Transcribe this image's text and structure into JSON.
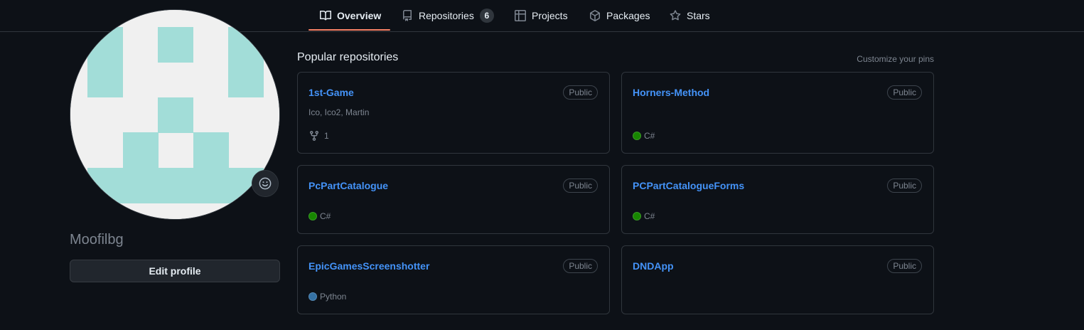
{
  "nav": {
    "tabs": [
      {
        "label": "Overview",
        "icon": "book-icon"
      },
      {
        "label": "Repositories",
        "icon": "repo-icon",
        "count": "6"
      },
      {
        "label": "Projects",
        "icon": "table-icon"
      },
      {
        "label": "Packages",
        "icon": "package-icon"
      },
      {
        "label": "Stars",
        "icon": "star-icon"
      }
    ],
    "selected": "Overview",
    "underline_color": "#f78166"
  },
  "profile": {
    "username": "Moofilbg",
    "edit_label": "Edit profile",
    "avatar_colors": {
      "background": "#f0f0f0",
      "foreground": "#a2ddd8"
    }
  },
  "pinned": {
    "title": "Popular repositories",
    "customize_label": "Customize your pins",
    "repos": [
      {
        "name": "1st-Game",
        "visibility": "Public",
        "description": "Ico, Ico2, Martin",
        "forks": "1"
      },
      {
        "name": "Horners-Method",
        "visibility": "Public",
        "language": "C#",
        "language_color": "#178600"
      },
      {
        "name": "PcPartCatalogue",
        "visibility": "Public",
        "language": "C#",
        "language_color": "#178600"
      },
      {
        "name": "PCPartCatalogueForms",
        "visibility": "Public",
        "language": "C#",
        "language_color": "#178600"
      },
      {
        "name": "EpicGamesScreenshotter",
        "visibility": "Public",
        "language": "Python",
        "language_color": "#3572A5"
      },
      {
        "name": "DNDApp",
        "visibility": "Public"
      }
    ]
  },
  "colors": {
    "link": "#4493f8",
    "muted": "#7d8590",
    "border": "#30363d",
    "background": "#0d1117"
  }
}
